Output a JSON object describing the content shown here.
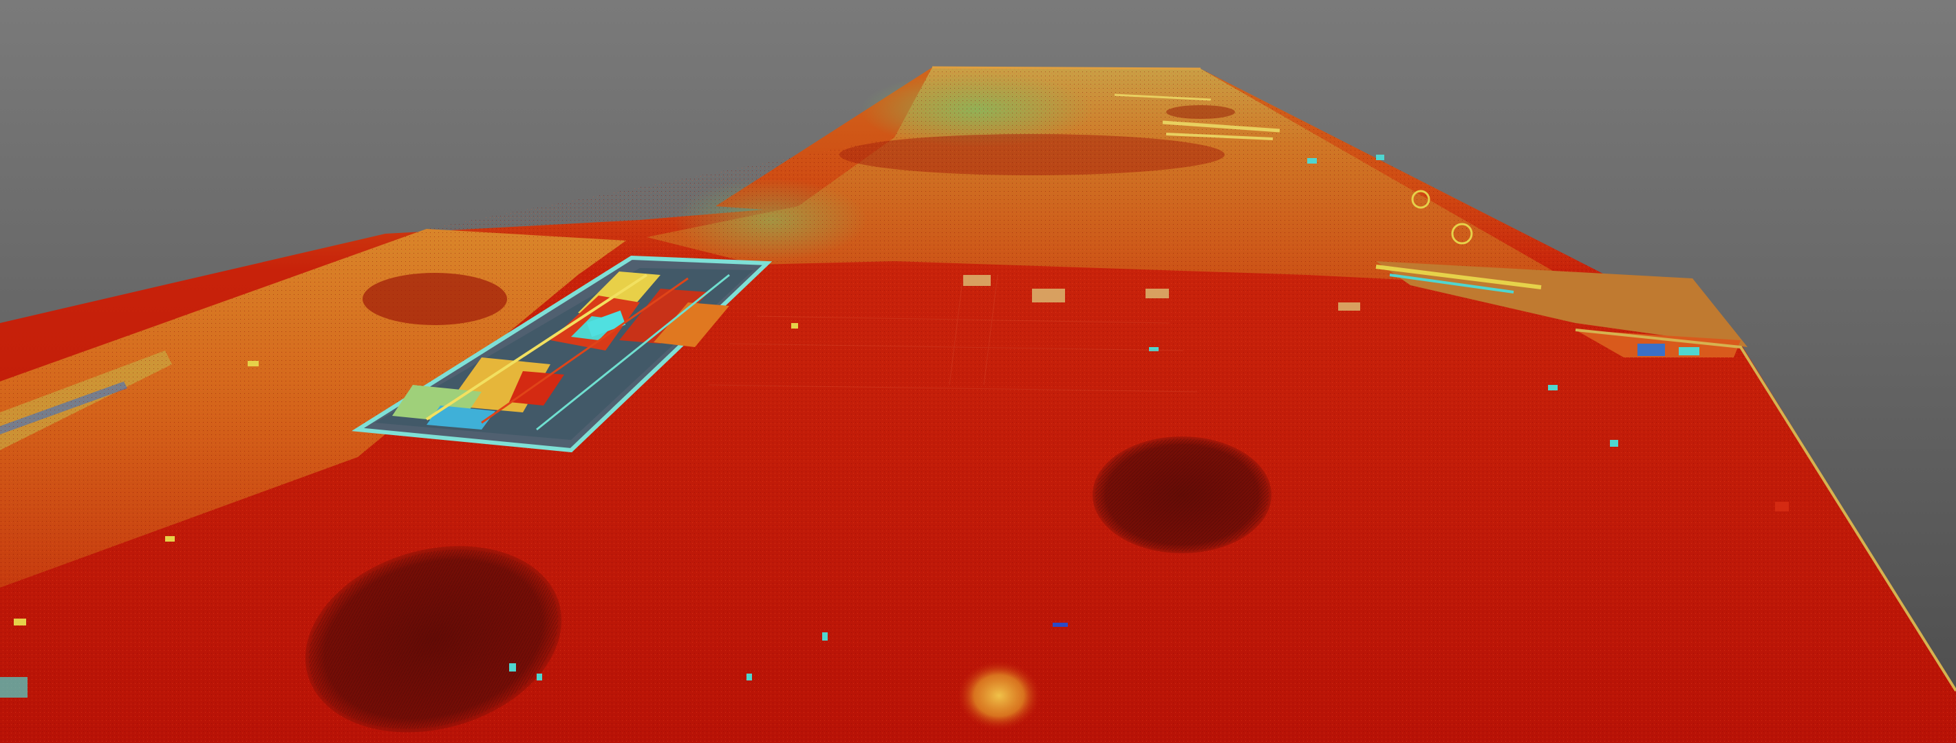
{
  "viewer": {
    "colors": {
      "background_top": "#7a7a7a",
      "background_bottom": "#4c4c4c",
      "ground_near": "#c01408",
      "ground_mid": "#d83a10",
      "ground_far": "#d8781e",
      "vegetation": "#9fbf5a",
      "structure_cyan": "#4fd6d0",
      "structure_yellow": "#e6d24a"
    },
    "point_cloud": {
      "circular_patches": 4,
      "structures": [
        "left-wing-building",
        "center-depressed-yard",
        "right-dock-structure",
        "far-end-buildings"
      ]
    }
  }
}
